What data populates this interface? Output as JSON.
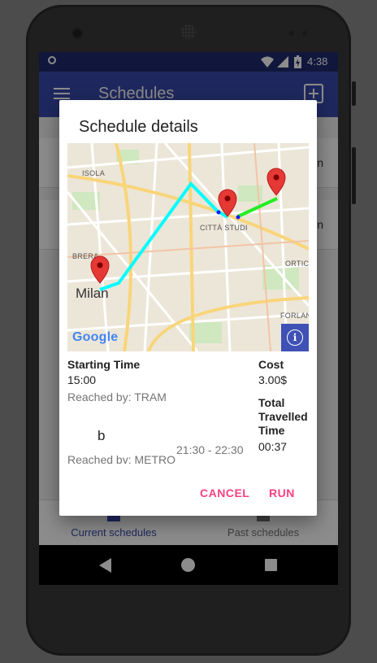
{
  "device": {
    "status": {
      "time": "4:38"
    }
  },
  "app": {
    "title": "Schedules",
    "rows": [
      {
        "suffix": "n"
      },
      {
        "suffix": "n"
      }
    ],
    "tabs": [
      {
        "label": "Current schedules"
      },
      {
        "label": "Past schedules"
      }
    ]
  },
  "dialog": {
    "title": "Schedule details",
    "map": {
      "labels": [
        "ISOLA",
        "BRERA",
        "Milan",
        "CITTÀ STUDI",
        "ORTICA",
        "FORLANINI"
      ],
      "attribution": "Google",
      "route_colors": {
        "first_leg": "#00ffff",
        "second_leg": "#22ee22",
        "pins": "#e53935"
      }
    },
    "starting_time_label": "Starting Time",
    "starting_time": "15:00",
    "reached_by_1": "Reached by: TRAM",
    "stop_b": "b",
    "time_range": "21:30 - 22:30",
    "reached_by_2": "Reached by: METRO",
    "cost_label": "Cost",
    "cost": "3.00$",
    "total_label_line1": "Total",
    "total_label_line2": "Travelled",
    "total_label_line3": "Time",
    "total_time": "00:37",
    "cancel_label": "CANCEL",
    "run_label": "RUN"
  }
}
